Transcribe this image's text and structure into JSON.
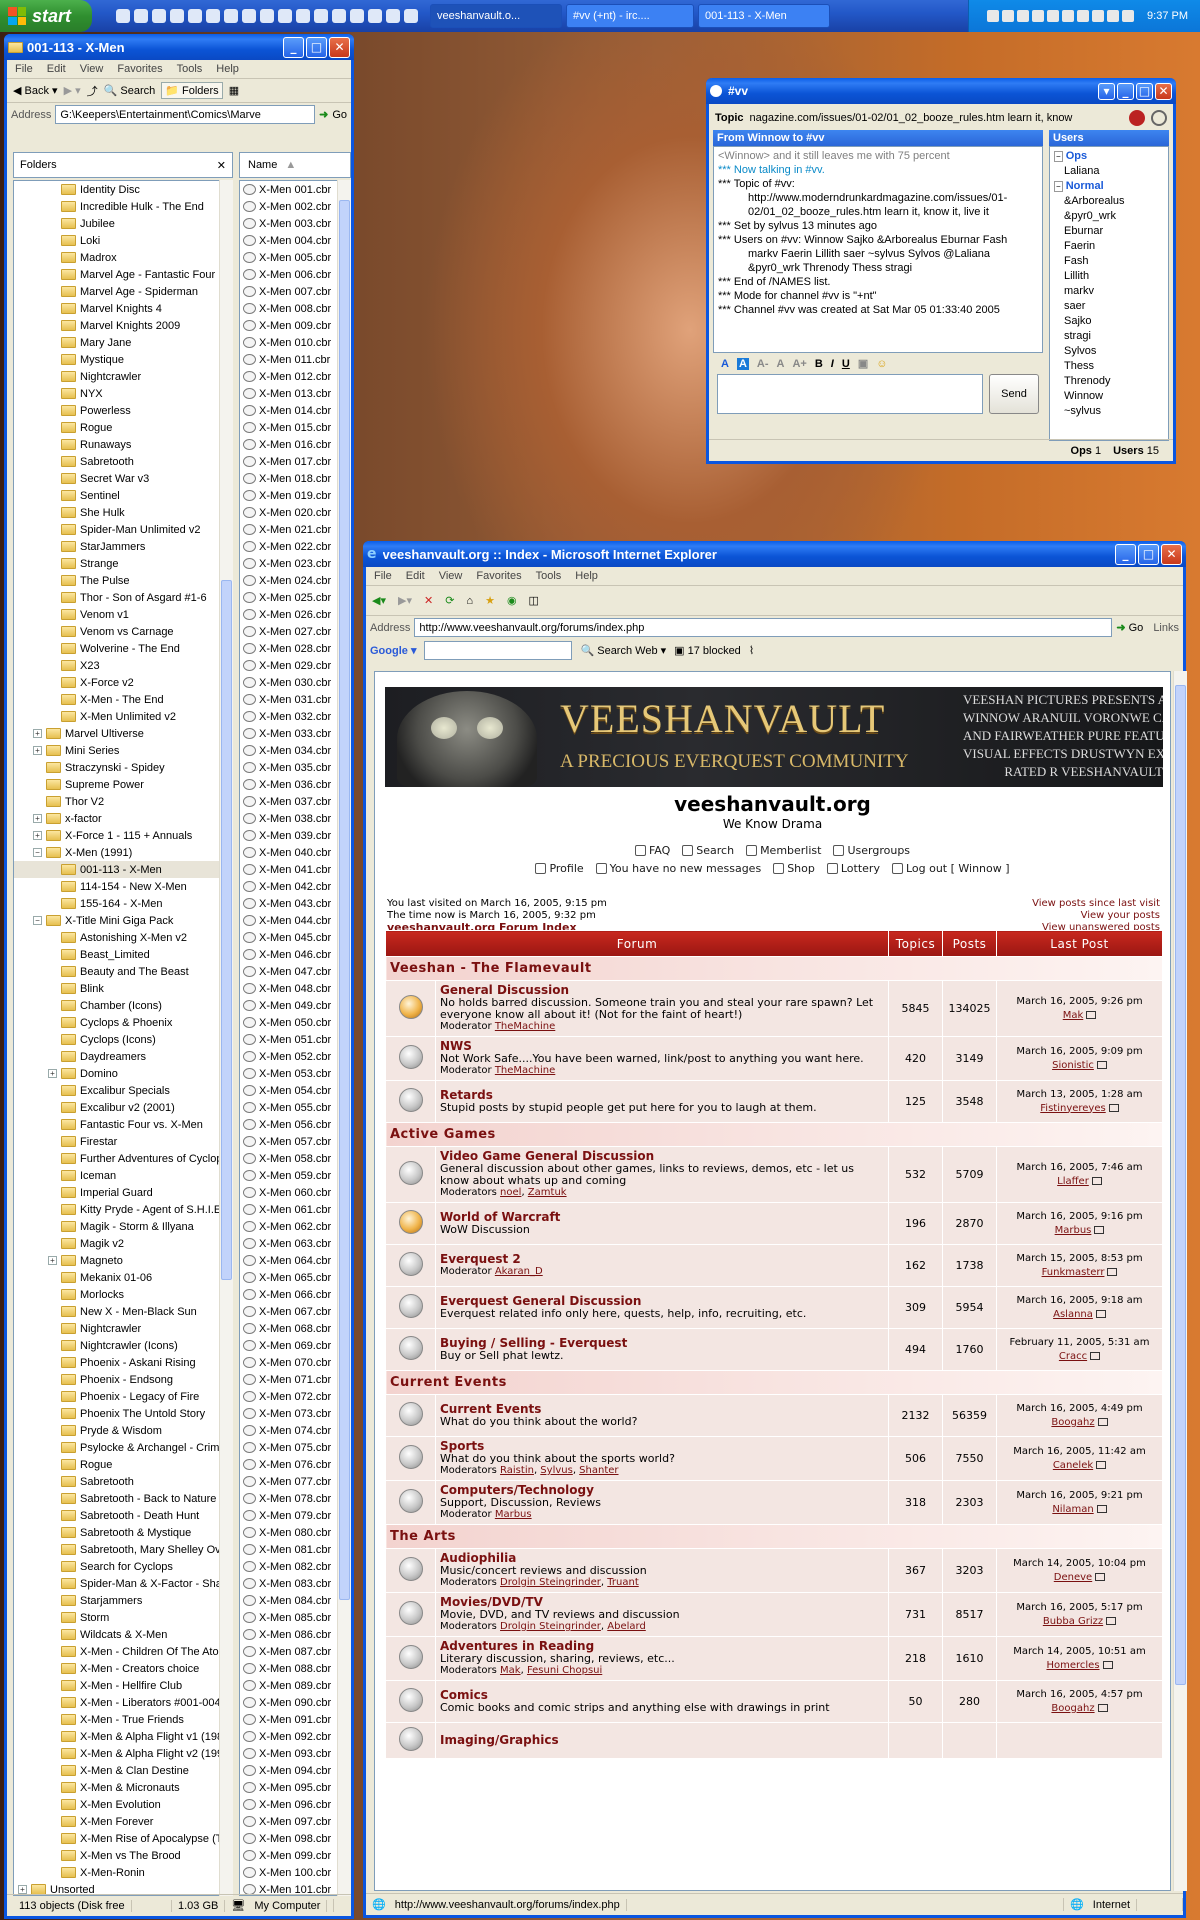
{
  "taskbar": {
    "start": "start",
    "tasks": [
      "veeshanvault.o...",
      "#vv (+nt) - irc....",
      "001-113 - X-Men"
    ],
    "clock": "9:37 PM"
  },
  "explorer": {
    "title": "001-113 - X-Men",
    "menu": [
      "File",
      "Edit",
      "View",
      "Favorites",
      "Tools",
      "Help"
    ],
    "back": "Back",
    "search": "Search",
    "folders": "Folders",
    "address_label": "Address",
    "address": "G:\\Keepers\\Entertainment\\Comics\\Marve",
    "go": "Go",
    "folders_header": "Folders",
    "name_header": "Name",
    "tree": [
      {
        "t": "Identity Disc",
        "d": 2
      },
      {
        "t": "Incredible Hulk - The End",
        "d": 2
      },
      {
        "t": "Jubilee",
        "d": 2
      },
      {
        "t": "Loki",
        "d": 2
      },
      {
        "t": "Madrox",
        "d": 2
      },
      {
        "t": "Marvel Age - Fantastic Four",
        "d": 2
      },
      {
        "t": "Marvel Age - Spiderman",
        "d": 2
      },
      {
        "t": "Marvel Knights 4",
        "d": 2
      },
      {
        "t": "Marvel Knights 2009",
        "d": 2
      },
      {
        "t": "Mary Jane",
        "d": 2
      },
      {
        "t": "Mystique",
        "d": 2
      },
      {
        "t": "Nightcrawler",
        "d": 2
      },
      {
        "t": "NYX",
        "d": 2
      },
      {
        "t": "Powerless",
        "d": 2
      },
      {
        "t": "Rogue",
        "d": 2
      },
      {
        "t": "Runaways",
        "d": 2
      },
      {
        "t": "Sabretooth",
        "d": 2
      },
      {
        "t": "Secret War v3",
        "d": 2
      },
      {
        "t": "Sentinel",
        "d": 2
      },
      {
        "t": "She Hulk",
        "d": 2
      },
      {
        "t": "Spider-Man Unlimited v2",
        "d": 2
      },
      {
        "t": "StarJammers",
        "d": 2
      },
      {
        "t": "Strange",
        "d": 2
      },
      {
        "t": "The Pulse",
        "d": 2
      },
      {
        "t": "Thor - Son of Asgard #1-6",
        "d": 2
      },
      {
        "t": "Venom v1",
        "d": 2
      },
      {
        "t": "Venom vs Carnage",
        "d": 2
      },
      {
        "t": "Wolverine - The End",
        "d": 2
      },
      {
        "t": "X23",
        "d": 2
      },
      {
        "t": "X-Force v2",
        "d": 2
      },
      {
        "t": "X-Men - The End",
        "d": 2
      },
      {
        "t": "X-Men Unlimited v2",
        "d": 2
      },
      {
        "t": "Marvel Ultiverse",
        "d": 1,
        "p": "+"
      },
      {
        "t": "Mini Series",
        "d": 1,
        "p": "+"
      },
      {
        "t": "Straczynski - Spidey",
        "d": 1
      },
      {
        "t": "Supreme Power",
        "d": 1
      },
      {
        "t": "Thor V2",
        "d": 1
      },
      {
        "t": "x-factor",
        "d": 1,
        "p": "+"
      },
      {
        "t": "X-Force 1 - 115 + Annuals",
        "d": 1,
        "p": "+"
      },
      {
        "t": "X-Men (1991)",
        "d": 1,
        "p": "-"
      },
      {
        "t": "001-113 - X-Men",
        "d": 2,
        "sel": true
      },
      {
        "t": "114-154 - New X-Men",
        "d": 2
      },
      {
        "t": "155-164 - X-Men",
        "d": 2
      },
      {
        "t": "X-Title Mini Giga Pack",
        "d": 1,
        "p": "-"
      },
      {
        "t": "Astonishing X-Men v2",
        "d": 2
      },
      {
        "t": "Beast_Limited",
        "d": 2
      },
      {
        "t": "Beauty and The Beast",
        "d": 2
      },
      {
        "t": "Blink",
        "d": 2
      },
      {
        "t": "Chamber (Icons)",
        "d": 2
      },
      {
        "t": "Cyclops & Phoenix",
        "d": 2
      },
      {
        "t": "Cyclops (Icons)",
        "d": 2
      },
      {
        "t": "Daydreamers",
        "d": 2
      },
      {
        "t": "Domino",
        "d": 2,
        "p": "+"
      },
      {
        "t": "Excalibur Specials",
        "d": 2
      },
      {
        "t": "Excalibur v2 (2001)",
        "d": 2
      },
      {
        "t": "Fantastic Four vs. X-Men",
        "d": 2
      },
      {
        "t": "Firestar",
        "d": 2
      },
      {
        "t": "Further Adventures of Cyclop",
        "d": 2
      },
      {
        "t": "Iceman",
        "d": 2
      },
      {
        "t": "Imperial Guard",
        "d": 2
      },
      {
        "t": "Kitty Pryde - Agent of S.H.I.E",
        "d": 2
      },
      {
        "t": "Magik - Storm & Illyana",
        "d": 2
      },
      {
        "t": "Magik v2",
        "d": 2
      },
      {
        "t": "Magneto",
        "d": 2,
        "p": "+"
      },
      {
        "t": "Mekanix 01-06",
        "d": 2
      },
      {
        "t": "Morlocks",
        "d": 2
      },
      {
        "t": "New X - Men-Black Sun",
        "d": 2
      },
      {
        "t": "Nightcrawler",
        "d": 2
      },
      {
        "t": "Nightcrawler (Icons)",
        "d": 2
      },
      {
        "t": "Phoenix - Askani Rising",
        "d": 2
      },
      {
        "t": "Phoenix - Endsong",
        "d": 2
      },
      {
        "t": "Phoenix - Legacy of Fire",
        "d": 2
      },
      {
        "t": "Phoenix The Untold Story",
        "d": 2
      },
      {
        "t": "Pryde & Wisdom",
        "d": 2
      },
      {
        "t": "Psylocke & Archangel - Crimso",
        "d": 2
      },
      {
        "t": "Rogue",
        "d": 2
      },
      {
        "t": "Sabretooth",
        "d": 2
      },
      {
        "t": "Sabretooth - Back to Nature",
        "d": 2
      },
      {
        "t": "Sabretooth - Death Hunt",
        "d": 2
      },
      {
        "t": "Sabretooth & Mystique",
        "d": 2
      },
      {
        "t": "Sabretooth, Mary Shelley Ove",
        "d": 2
      },
      {
        "t": "Search for Cyclops",
        "d": 2
      },
      {
        "t": "Spider-Man & X-Factor - Shad",
        "d": 2
      },
      {
        "t": "Starjammers",
        "d": 2
      },
      {
        "t": "Storm",
        "d": 2
      },
      {
        "t": "Wildcats & X-Men",
        "d": 2
      },
      {
        "t": "X-Men - Children Of The Atom",
        "d": 2
      },
      {
        "t": "X-Men - Creators choice",
        "d": 2
      },
      {
        "t": "X-Men - Hellfire Club",
        "d": 2
      },
      {
        "t": "X-Men - Liberators #001-004",
        "d": 2
      },
      {
        "t": "X-Men - True Friends",
        "d": 2
      },
      {
        "t": "X-Men & Alpha Flight v1 (1985",
        "d": 2
      },
      {
        "t": "X-Men & Alpha Flight v2 (1998",
        "d": 2
      },
      {
        "t": "X-Men & Clan Destine",
        "d": 2
      },
      {
        "t": "X-Men & Micronauts",
        "d": 2
      },
      {
        "t": "X-Men Evolution",
        "d": 2
      },
      {
        "t": "X-Men Forever",
        "d": 2
      },
      {
        "t": "X-Men Rise of Apocalypse (Th",
        "d": 2
      },
      {
        "t": "X-Men vs The Brood",
        "d": 2
      },
      {
        "t": "X-Men-Ronin",
        "d": 2
      },
      {
        "t": "Unsorted",
        "d": 0,
        "p": "+"
      }
    ],
    "file_prefix": "X-Men ",
    "file_suffix": ".cbr",
    "file_count_shown": 101,
    "status_objects": "113 objects (Disk free",
    "status_size": "1.03 GB",
    "status_location": "My Computer"
  },
  "irc": {
    "title": "#vv",
    "topic_label": "Topic",
    "topic_value": "nagazine.com/issues/01-02/01_02_booze_rules.htm learn it, know",
    "from_header": "From Winnow to #vv",
    "users_header": "Users",
    "messages": [
      {
        "text": "<Winnow> and it still leaves me with 75 percent",
        "c": "#808080"
      },
      {
        "text": "*** Now talking in #vv.",
        "c": "#0a8ac8"
      },
      {
        "text": "*** Topic of #vv: http://www.moderndrunkardmagazine.com/issues/01-02/01_02_booze_rules.htm learn it, know it, live it",
        "c": "#000"
      },
      {
        "text": "*** Set by sylvus 13 minutes ago",
        "c": "#000"
      },
      {
        "text": "*** Users on #vv: Winnow Sajko &Arborealus Eburnar Fash markv Faerin Lillith saer ~sylvus Sylvos @Laliana &pyr0_wrk Threnody Thess stragi",
        "c": "#000"
      },
      {
        "text": "*** End of /NAMES list.",
        "c": "#000"
      },
      {
        "text": "*** Mode for channel #vv is \"+nt\"",
        "c": "#000"
      },
      {
        "text": "*** Channel #vv was created at Sat Mar 05 01:33:40 2005",
        "c": "#000"
      }
    ],
    "ops_label": "Ops",
    "normal_label": "Normal",
    "ops": [
      "Laliana"
    ],
    "normal": [
      "&Arborealus",
      "&pyr0_wrk",
      "Eburnar",
      "Faerin",
      "Fash",
      "Lillith",
      "markv",
      "saer",
      "Sajko",
      "stragi",
      "Sylvos",
      "Thess",
      "Threnody",
      "Winnow",
      "~sylvus"
    ],
    "send": "Send",
    "footer_ops_label": "Ops",
    "footer_ops": "1",
    "footer_users_label": "Users",
    "footer_users": "15"
  },
  "ie": {
    "title": "veeshanvault.org :: Index - Microsoft Internet Explorer",
    "menu": [
      "File",
      "Edit",
      "View",
      "Favorites",
      "Tools",
      "Help"
    ],
    "address_label": "Address",
    "url": "http://www.veeshanvault.org/forums/index.php",
    "go": "Go",
    "links": "Links",
    "google": "Google",
    "search_web": "Search Web",
    "blocked": "17 blocked",
    "status_url": "http://www.veeshanvault.org/forums/index.php",
    "zone": "Internet"
  },
  "site": {
    "banner_title": "VEESHANVAULT",
    "banner_sub": "A PRECIOUS EVERQUEST COMMUNITY",
    "banner_right": [
      "VEESHAN PICTURES PRESENTS A V",
      "WINNOW ARANUIL VORONWE CARTA",
      "AND FAIRWEATHER PURE FEATURING \"TEH CL",
      "VISUAL EFFECTS DRUSTWYN EXECUTIVE PR",
      "RATED R   VEESHANVAULT"
    ],
    "name": "veeshanvault.org",
    "tagline": "We Know Drama",
    "nav1": [
      "FAQ",
      "Search",
      "Memberlist",
      "Usergroups"
    ],
    "nav2": [
      "Profile",
      "You have no new messages",
      "Shop",
      "Lottery",
      "Log out [ Winnow ]"
    ],
    "last_visit": "You last visited on March 16, 2005, 9:15 pm",
    "time_now": "The time now is March 16, 2005, 9:32 pm",
    "index_link": "veeshanvault.org Forum Index",
    "right_links": [
      "View posts since last visit",
      "View your posts",
      "View unanswered posts"
    ],
    "headers": [
      "Forum",
      "Topics",
      "Posts",
      "Last Post"
    ],
    "categories": [
      {
        "name": "Veeshan - The Flamevault",
        "forums": [
          {
            "title": "General Discussion",
            "desc": "No holds barred discussion. Someone train you and steal your rare spawn? Let everyone know all about it! (Not for the faint of heart!)",
            "mod_label": "Moderator",
            "mods": [
              "TheMachine"
            ],
            "topics": "5845",
            "posts": "134025",
            "last": "March 16, 2005, 9:26 pm",
            "by": "Mak",
            "new": true
          },
          {
            "title": "NWS",
            "desc": "Not Work Safe....You have been warned, link/post to anything you want here.",
            "mod_label": "Moderator",
            "mods": [
              "TheMachine"
            ],
            "topics": "420",
            "posts": "3149",
            "last": "March 16, 2005, 9:09 pm",
            "by": "Sionistic",
            "new": false
          },
          {
            "title": "Retards",
            "desc": "Stupid posts by stupid people get put here for you to laugh at them.",
            "mod_label": "",
            "mods": [],
            "topics": "125",
            "posts": "3548",
            "last": "March 13, 2005, 1:28 am",
            "by": "Fistinyereyes",
            "new": false
          }
        ]
      },
      {
        "name": "Active Games",
        "forums": [
          {
            "title": "Video Game General Discussion",
            "desc": "General discussion about other games, links to reviews, demos, etc - let us know about whats up and coming",
            "mod_label": "Moderators",
            "mods": [
              "noel",
              "Zamtuk"
            ],
            "topics": "532",
            "posts": "5709",
            "last": "March 16, 2005, 7:46 am",
            "by": "Llaffer",
            "new": false
          },
          {
            "title": "World of Warcraft",
            "desc": "WoW Discussion",
            "mod_label": "",
            "mods": [],
            "topics": "196",
            "posts": "2870",
            "last": "March 16, 2005, 9:16 pm",
            "by": "Marbus",
            "new": true
          },
          {
            "title": "Everquest 2",
            "desc": "",
            "mod_label": "Moderator",
            "mods": [
              "Akaran_D"
            ],
            "topics": "162",
            "posts": "1738",
            "last": "March 15, 2005, 8:53 pm",
            "by": "Funkmasterr",
            "new": false
          },
          {
            "title": "Everquest General Discussion",
            "desc": "Everquest related info only here, quests, help, info, recruiting, etc.",
            "mod_label": "",
            "mods": [],
            "topics": "309",
            "posts": "5954",
            "last": "March 16, 2005, 9:18 am",
            "by": "Aslanna",
            "new": false
          },
          {
            "title": "Buying / Selling - Everquest",
            "desc": "Buy or Sell phat lewtz.",
            "mod_label": "",
            "mods": [],
            "topics": "494",
            "posts": "1760",
            "last": "February 11, 2005, 5:31 am",
            "by": "Cracc",
            "new": false
          }
        ]
      },
      {
        "name": "Current Events",
        "forums": [
          {
            "title": "Current Events",
            "desc": "What do you think about the world?",
            "mod_label": "",
            "mods": [],
            "topics": "2132",
            "posts": "56359",
            "last": "March 16, 2005, 4:49 pm",
            "by": "Boogahz",
            "new": false
          },
          {
            "title": "Sports",
            "desc": "What do you think about the sports world?",
            "mod_label": "Moderators",
            "mods": [
              "Raistin",
              "Sylvus",
              "Shanter"
            ],
            "topics": "506",
            "posts": "7550",
            "last": "March 16, 2005, 11:42 am",
            "by": "Canelek",
            "new": false
          },
          {
            "title": "Computers/Technology",
            "desc": "Support, Discussion, Reviews",
            "mod_label": "Moderator",
            "mods": [
              "Marbus"
            ],
            "topics": "318",
            "posts": "2303",
            "last": "March 16, 2005, 9:21 pm",
            "by": "Nilaman",
            "new": false
          }
        ]
      },
      {
        "name": "The Arts",
        "forums": [
          {
            "title": "Audiophilia",
            "desc": "Music/concert reviews and discussion",
            "mod_label": "Moderators",
            "mods": [
              "Drolgin Steingrinder",
              "Truant"
            ],
            "topics": "367",
            "posts": "3203",
            "last": "March 14, 2005, 10:04 pm",
            "by": "Deneve",
            "new": false
          },
          {
            "title": "Movies/DVD/TV",
            "desc": "Movie, DVD, and TV reviews and discussion",
            "mod_label": "Moderators",
            "mods": [
              "Drolgin Steingrinder",
              "Abelard"
            ],
            "topics": "731",
            "posts": "8517",
            "last": "March 16, 2005, 5:17 pm",
            "by": "Bubba Grizz",
            "new": false
          },
          {
            "title": "Adventures in Reading",
            "desc": "Literary discussion, sharing, reviews, etc...",
            "mod_label": "Moderators",
            "mods": [
              "Mak",
              "Fesuni Chopsui"
            ],
            "topics": "218",
            "posts": "1610",
            "last": "March 14, 2005, 10:51 am",
            "by": "Homercles",
            "new": false
          },
          {
            "title": "Comics",
            "desc": "Comic books and comic strips and anything else with drawings in print",
            "mod_label": "",
            "mods": [],
            "topics": "50",
            "posts": "280",
            "last": "March 16, 2005, 4:57 pm",
            "by": "Boogahz",
            "new": false
          },
          {
            "title": "Imaging/Graphics",
            "desc": "",
            "mod_label": "",
            "mods": [],
            "topics": "",
            "posts": "",
            "last": "",
            "by": "",
            "new": false
          }
        ]
      }
    ]
  },
  "colors": {
    "xp_blue": "#0a56e0",
    "forum_red": "#9a1612",
    "cat_text": "#7a1010",
    "start_green": "#2f8f2f"
  }
}
